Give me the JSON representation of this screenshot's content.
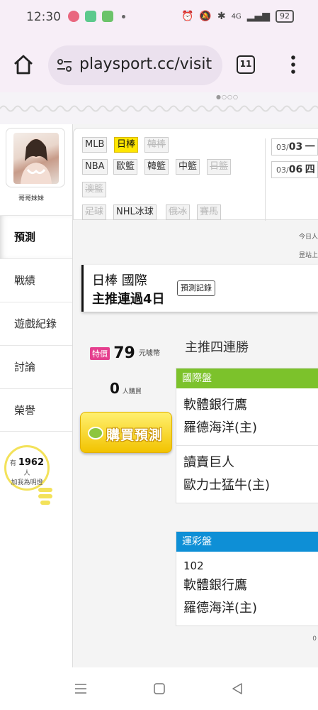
{
  "status_bar": {
    "time": "12:30",
    "network": "4G",
    "battery": "92"
  },
  "browser": {
    "url": "playsport.cc/visit",
    "tab_count": "11"
  },
  "sidebar": {
    "user_name": "哥哥妹妹",
    "items": [
      {
        "label": "預測"
      },
      {
        "label": "戰績"
      },
      {
        "label": "遊戲紀錄"
      },
      {
        "label": "討論"
      },
      {
        "label": "榮譽"
      }
    ],
    "fans": {
      "prefix": "有",
      "count": "1962",
      "unit": "人",
      "caption": "加我為明燈"
    }
  },
  "sport_tags": [
    {
      "label": "MLB",
      "state": "normal"
    },
    {
      "label": "日棒",
      "state": "selected"
    },
    {
      "label": "韓棒",
      "state": "disabled"
    },
    {
      "label": "NBA",
      "state": "normal"
    },
    {
      "label": "歐籃",
      "state": "normal"
    },
    {
      "label": "韓籃",
      "state": "normal"
    },
    {
      "label": "中籃",
      "state": "normal"
    },
    {
      "label": "日籃",
      "state": "disabled"
    },
    {
      "label": "澳籃",
      "state": "disabled"
    },
    {
      "label": "足球",
      "state": "disabled"
    },
    {
      "label": "NHL冰球",
      "state": "normal"
    },
    {
      "label": "俄冰",
      "state": "disabled"
    },
    {
      "label": "賽馬",
      "state": "disabled"
    }
  ],
  "dates": [
    {
      "month": "03/",
      "day": "03",
      "weekday": "一"
    },
    {
      "month": "03/",
      "day": "06",
      "weekday": "四"
    }
  ],
  "hints": {
    "line1": "今日人",
    "line2": "昰站上"
  },
  "match": {
    "title": "日棒 國際",
    "subtitle": "主推連過4日",
    "record_button": "預測記錄"
  },
  "offer": {
    "badge": "特價",
    "price": "79",
    "currency": "元噱幣",
    "buyers": "0",
    "buyers_unit": "人購買",
    "buy_button": "購買預測"
  },
  "streak": "主推四連勝",
  "picks": [
    {
      "header": "國際盤",
      "color": "#7cc22b",
      "games": [
        {
          "away": "軟體銀行鷹",
          "home": "羅德海洋(主)"
        },
        {
          "away": "讀賣巨人",
          "home": "歐力士猛牛(主)"
        }
      ]
    },
    {
      "header": "運彩盤",
      "color": "#0e8fd6",
      "games": [
        {
          "code": "102",
          "away": "軟體銀行鷹",
          "home": "羅德海洋(主)"
        }
      ]
    }
  ],
  "tiny_number": "0"
}
